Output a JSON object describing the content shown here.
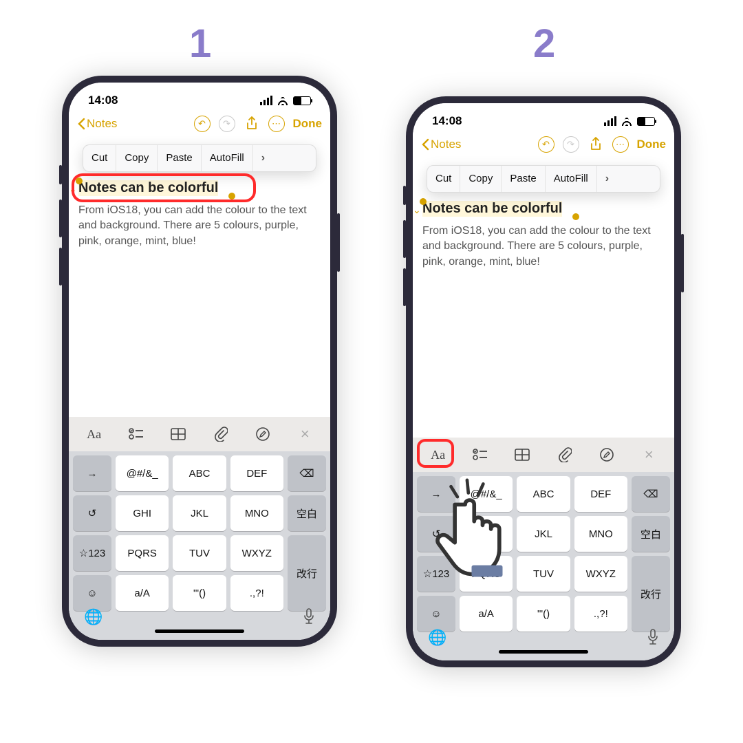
{
  "steps": {
    "one": "1",
    "two": "2"
  },
  "status": {
    "time": "14:08"
  },
  "nav": {
    "back": "Notes",
    "done": "Done"
  },
  "popover": {
    "cut": "Cut",
    "copy": "Copy",
    "paste": "Paste",
    "autofill": "AutoFill"
  },
  "note": {
    "heading": "Notes can be colorful",
    "body": "From iOS18, you can add the colour to the text and background. There are 5 colours, purple, pink, orange, mint, blue!"
  },
  "toolbar": {
    "aa": "Aa",
    "close": "×"
  },
  "keys": {
    "sym": "@#/&_",
    "abc": "ABC",
    "def": "DEF",
    "ghi": "GHI",
    "jkl": "JKL",
    "mno": "MNO",
    "pqrs": "PQRS",
    "tuv": "TUV",
    "wxyz": "WXYZ",
    "case": "a/A",
    "quotes": "'\"()",
    "punct": ".,?!",
    "num": "☆123",
    "arrow": "→",
    "undo": "↺",
    "space": "空白",
    "enter": "改行",
    "bksp": "⌫",
    "emoji": "☺"
  }
}
